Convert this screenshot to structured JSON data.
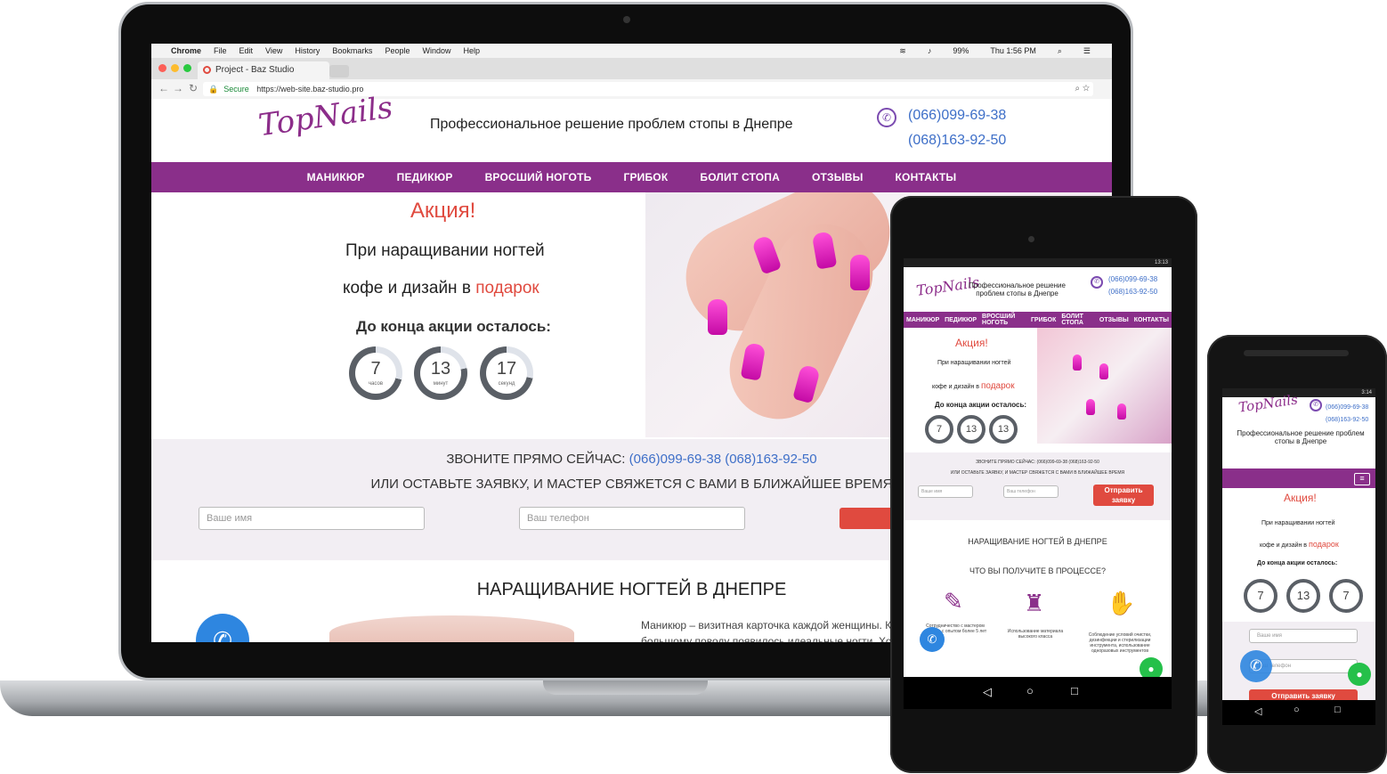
{
  "browser": {
    "mac_menu": [
      "Chrome",
      "File",
      "Edit",
      "View",
      "History",
      "Bookmarks",
      "People",
      "Window",
      "Help"
    ],
    "battery": "99%",
    "clock": "Thu 1:56 PM",
    "tab_title": "Project - Baz Studio",
    "secure_label": "Secure",
    "url": "https://web-site.baz-studio.pro"
  },
  "site": {
    "logo": "TopNails",
    "tagline": "Профессиональное решение проблем стопы в Днепре",
    "phone1": "(066)099-69-38",
    "phone2": "(068)163-92-50",
    "menu": [
      "МАНИКЮР",
      "ПЕДИКЮР",
      "ВРОСШИЙ НОГОТЬ",
      "ГРИБОК",
      "БОЛИТ СТОПА",
      "ОТЗЫВЫ",
      "КОНТАКТЫ"
    ],
    "promo_title": "Акция!",
    "promo_line1": "При наращивании ногтей",
    "promo_line2": "кофе и дизайн в ",
    "promo_gift": "подарок",
    "countdown_label": "До конца акции осталось:",
    "countdown": [
      {
        "value": "7",
        "unit": "часов",
        "fraction": 0.29
      },
      {
        "value": "13",
        "unit": "минут",
        "fraction": 0.22
      },
      {
        "value": "17",
        "unit": "секунд",
        "fraction": 0.28
      }
    ],
    "call_prefix": "ЗВОНИТЕ ПРЯМО СЕЙЧАС: ",
    "call_phones": "(066)099-69-38 (068)163-92-50",
    "call_line2": "ИЛИ ОСТАВЬТЕ ЗАЯВКУ, И МАСТЕР СВЯЖЕТСЯ С ВАМИ В БЛИЖАЙШЕЕ ВРЕМЯ",
    "name_placeholder": "Ваше имя",
    "phone_placeholder": "Ваш телефон",
    "send_label": "Отправить заявку",
    "section_title": "НАРАЩИВАНИЕ НОГТЕЙ В ДНЕПРЕ",
    "paragraph_start": "Маникюр – визитная карточка каждой женщины. К",
    "paragraph_2": "большому поводу появилось идеальные ногти. Хоть м"
  },
  "tablet": {
    "status_time": "13:13",
    "menu": [
      "МАНИКЮР",
      "ПЕДИКЮР",
      "ВРОСШИЙ НОГОТЬ",
      "ГРИБОК",
      "БОЛИТ СТОПА",
      "ОТЗЫВЫ",
      "КОНТАКТЫ"
    ],
    "tagline": "Профессиональное решение проблем стопы в Днепре",
    "countdown": [
      "7",
      "13",
      "13"
    ],
    "call_line1": "ЗВОНИТЕ ПРЯМО СЕЙЧАС: (066)099-69-38 (068)163-92-50",
    "call_line2": "ИЛИ ОСТАВЬТЕ ЗАЯВКУ, И МАСТЕР СВЯЖЕТСЯ С ВАМИ В БЛИЖАЙШЕЕ ВРЕМЯ",
    "send_label": "Отправить заявку",
    "section_title": "НАРАЩИВАНИЕ НОГТЕЙ В ДНЕПРЕ",
    "subtitle": "ЧТО ВЫ ПОЛУЧИТЕ В ПРОЦЕССЕ?",
    "feature1": "Сотрудничество с мастером сервиса с опытом более 5 лет",
    "feature2": "Использование материала высокого класса",
    "feature3": "Соблюдение условий очистки, дезинфекции и стерилизации инструмента, использование одноразовых инструментов"
  },
  "phone": {
    "status_time": "3:14",
    "countdown": [
      "7",
      "13",
      "7"
    ],
    "send_label": "Отправить заявку"
  },
  "colors": {
    "brand": "#8a2f8a",
    "accent": "#e04a3f",
    "link": "#3e6fc8"
  }
}
